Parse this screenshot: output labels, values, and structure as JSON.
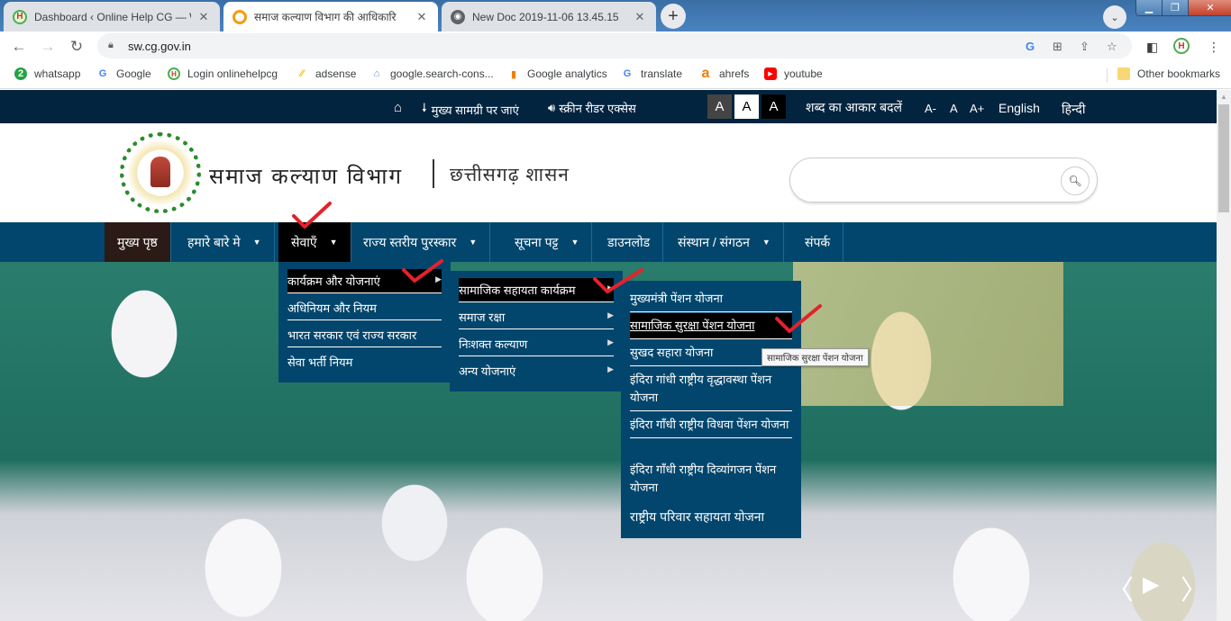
{
  "browser": {
    "tabs": [
      {
        "title": "Dashboard ‹ Online Help CG — W",
        "icon": "onlinehelp-favicon",
        "active": false
      },
      {
        "title": "समाज कल्याण विभाग की आधिकारि",
        "icon": "site-favicon",
        "active": true
      },
      {
        "title": "New Doc 2019-11-06 13.45.15",
        "icon": "globe-favicon",
        "active": false
      }
    ],
    "new_tab_label": "+",
    "url": "sw.cg.gov.in",
    "bookmarks": [
      {
        "label": "whatsapp",
        "icon": "whatsapp-icon"
      },
      {
        "label": "Google",
        "icon": "google-icon"
      },
      {
        "label": "Login onlinehelpcg",
        "icon": "onlinehelp-icon"
      },
      {
        "label": "adsense",
        "icon": "adsense-icon"
      },
      {
        "label": "google.search-cons...",
        "icon": "search-console-icon"
      },
      {
        "label": "Google analytics",
        "icon": "analytics-icon"
      },
      {
        "label": "translate",
        "icon": "google-icon"
      },
      {
        "label": "ahrefs",
        "icon": "ahrefs-icon"
      },
      {
        "label": "youtube",
        "icon": "youtube-icon"
      }
    ],
    "other_bookmarks": "Other bookmarks"
  },
  "topbar": {
    "skip_to_content": "मुख्य सामग्री पर जाएं",
    "screen_reader": "स्क्रीन रीडर एक्सेस",
    "contrast_labels": [
      "A",
      "A",
      "A"
    ],
    "font_size_label": "शब्द का आकार बदलें",
    "font_minus": "A-",
    "font_normal": "A",
    "font_plus": "A+",
    "lang_english": "English",
    "lang_hindi": "हिन्दी"
  },
  "header": {
    "title": "समाज कल्याण विभाग",
    "subtitle": "छत्तीसगढ़ शासन",
    "search_placeholder": ""
  },
  "nav": {
    "items": [
      {
        "label": "मुख्य पृष्ठ",
        "dropdown": false
      },
      {
        "label": "हमारे बारे मे",
        "dropdown": true
      },
      {
        "label": "सेवाएँ",
        "dropdown": true
      },
      {
        "label": "राज्य स्तरीय पुरस्कार",
        "dropdown": true
      },
      {
        "label": "सूचना पट्ट",
        "dropdown": true
      },
      {
        "label": "डाउनलोड",
        "dropdown": false
      },
      {
        "label": "संस्थान / संगठन",
        "dropdown": true
      },
      {
        "label": "संपर्क",
        "dropdown": false
      }
    ]
  },
  "menu_level1": [
    {
      "label": "कार्यक्रम और योजनाएं",
      "submenu": true,
      "selected": true
    },
    {
      "label": "अधिनियम और नियम",
      "submenu": false
    },
    {
      "label": "भारत सरकार एवं राज्य सरकार",
      "submenu": false
    },
    {
      "label": "सेवा भर्ती नियम",
      "submenu": false
    }
  ],
  "menu_level2": [
    {
      "label": "सामाजिक सहायता कार्यक्रम",
      "submenu": true,
      "selected": true
    },
    {
      "label": "समाज रक्षा",
      "submenu": true
    },
    {
      "label": "निःशक्त कल्याण",
      "submenu": true
    },
    {
      "label": "अन्य योजनाएं",
      "submenu": true
    }
  ],
  "menu_level3": [
    {
      "label": "मुख्यमंत्री पेंशन योजना"
    },
    {
      "label": "सामाजिक सुरक्षा पेंशन योजना",
      "selected": true
    },
    {
      "label": "सुखद सहारा योजना"
    },
    {
      "label": "इंदिरा गांधी राष्ट्रीय वृद्धावस्था पेंशन योजना"
    },
    {
      "label": "इंदिरा गाँधी राष्ट्रीय विधवा पेंशन योजना"
    },
    {
      "label": "इंदिरा गाँधी राष्ट्रीय दिव्यांगजन पेंशन योजना"
    },
    {
      "label": "राष्ट्रीय परिवार सहायता योजना"
    }
  ],
  "tooltip": "सामाजिक सुरक्षा पेंशन योजना",
  "colors": {
    "topbar_bg": "#03243f",
    "nav_bg": "#03466d",
    "menu_bg": "#03466d",
    "selected_bg": "#000000",
    "annotation_check": "#e4222b"
  }
}
